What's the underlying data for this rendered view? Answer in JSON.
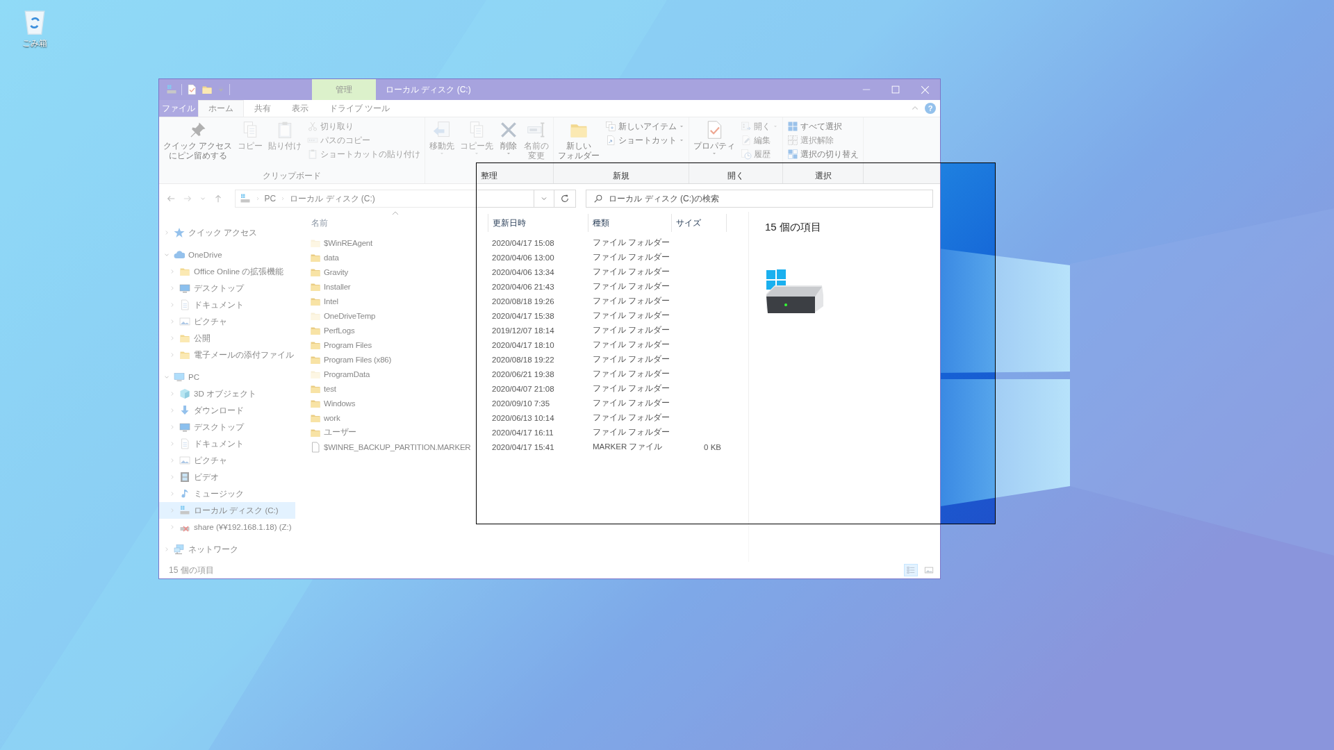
{
  "desktop_icons": [
    {
      "label": "ごみ箱"
    }
  ],
  "window": {
    "title": "ローカル ディスク (C:)",
    "context_tab": "管理"
  },
  "ribbon": {
    "tabs": [
      {
        "label": "ファイル",
        "kind": "file",
        "selected": false
      },
      {
        "label": "ホーム",
        "kind": "tab",
        "selected": true
      },
      {
        "label": "共有",
        "kind": "tab",
        "selected": false
      },
      {
        "label": "表示",
        "kind": "tab",
        "selected": false
      },
      {
        "label": "ドライブ ツール",
        "kind": "tab",
        "selected": false
      }
    ],
    "help": "?",
    "groups": [
      {
        "label": "クリップボード",
        "items": [
          {
            "kind": "large",
            "label": [
              "クイック アクセス",
              "にピン留めする"
            ],
            "disabled": false,
            "dropdown": false
          },
          {
            "kind": "large",
            "label": [
              "コピー"
            ],
            "disabled": true,
            "dropdown": false
          },
          {
            "kind": "large",
            "label": [
              "貼り付け"
            ],
            "disabled": true,
            "dropdown": false
          },
          {
            "kind": "small",
            "label": "切り取り",
            "disabled": true,
            "dropdown": false
          },
          {
            "kind": "small",
            "label": "パスのコピー",
            "disabled": true,
            "dropdown": false
          },
          {
            "kind": "small",
            "label": "ショートカットの貼り付け",
            "disabled": true,
            "dropdown": false
          }
        ]
      },
      {
        "label": "整理",
        "items": [
          {
            "kind": "large",
            "label": [
              "移動先"
            ],
            "disabled": true,
            "dropdown": true
          },
          {
            "kind": "large",
            "label": [
              "コピー先"
            ],
            "disabled": true,
            "dropdown": true
          },
          {
            "kind": "large",
            "label": [
              "削除"
            ],
            "disabled": false,
            "dropdown": true
          },
          {
            "kind": "large",
            "label": [
              "名前の",
              "変更"
            ],
            "disabled": true,
            "dropdown": false
          }
        ]
      },
      {
        "label": "新規",
        "items": [
          {
            "kind": "large",
            "label": [
              "新しい",
              "フォルダー"
            ],
            "disabled": false,
            "dropdown": false
          },
          {
            "kind": "small",
            "label": "新しいアイテム",
            "disabled": false,
            "dropdown": true
          },
          {
            "kind": "small",
            "label": "ショートカット",
            "disabled": false,
            "dropdown": true
          }
        ]
      },
      {
        "label": "開く",
        "items": [
          {
            "kind": "large",
            "label": [
              "プロパティ"
            ],
            "disabled": false,
            "dropdown": true
          },
          {
            "kind": "small",
            "label": "開く",
            "disabled": true,
            "dropdown": true
          },
          {
            "kind": "small",
            "label": "編集",
            "disabled": true,
            "dropdown": false
          },
          {
            "kind": "small",
            "label": "履歴",
            "disabled": true,
            "dropdown": false
          }
        ]
      },
      {
        "label": "選択",
        "items": [
          {
            "kind": "small",
            "label": "すべて選択",
            "disabled": false,
            "dropdown": false
          },
          {
            "kind": "small",
            "label": "選択解除",
            "disabled": true,
            "dropdown": false
          },
          {
            "kind": "small",
            "label": "選択の切り替え",
            "disabled": false,
            "dropdown": false
          }
        ]
      }
    ]
  },
  "address": {
    "crumbs": [
      "PC",
      "ローカル ディスク (C:)"
    ]
  },
  "search": {
    "placeholder": "ローカル ディスク (C:)の検索"
  },
  "nav": {
    "items": [
      {
        "label": "クイック アクセス",
        "kind": "star",
        "expanded": false,
        "selected": false
      },
      {
        "label": "OneDrive",
        "kind": "cloud",
        "expanded": true,
        "selected": false,
        "children": [
          {
            "label": "Office Online の拡張機能",
            "kind": "folder",
            "expanded": false,
            "selected": false
          },
          {
            "label": "デスクトップ",
            "kind": "desktop",
            "expanded": false,
            "selected": false
          },
          {
            "label": "ドキュメント",
            "kind": "document",
            "expanded": false,
            "selected": false
          },
          {
            "label": "ピクチャ",
            "kind": "picture",
            "expanded": false,
            "selected": false
          },
          {
            "label": "公開",
            "kind": "folder",
            "expanded": false,
            "selected": false
          },
          {
            "label": "電子メールの添付ファイル",
            "kind": "folder",
            "expanded": false,
            "selected": false
          }
        ]
      },
      {
        "label": "PC",
        "kind": "pc",
        "expanded": true,
        "selected": false,
        "children": [
          {
            "label": "3D オブジェクト",
            "kind": "cube",
            "expanded": false,
            "selected": false
          },
          {
            "label": "ダウンロード",
            "kind": "download",
            "expanded": false,
            "selected": false
          },
          {
            "label": "デスクトップ",
            "kind": "desktop",
            "expanded": false,
            "selected": false
          },
          {
            "label": "ドキュメント",
            "kind": "document",
            "expanded": false,
            "selected": false
          },
          {
            "label": "ピクチャ",
            "kind": "picture",
            "expanded": false,
            "selected": false
          },
          {
            "label": "ビデオ",
            "kind": "video",
            "expanded": false,
            "selected": false
          },
          {
            "label": "ミュージック",
            "kind": "music",
            "expanded": false,
            "selected": false
          },
          {
            "label": "ローカル ディスク (C:)",
            "kind": "drive",
            "expanded": false,
            "selected": true
          },
          {
            "label": "share (¥¥192.168.1.18) (Z:)",
            "kind": "netdrive",
            "expanded": false,
            "selected": false
          }
        ]
      },
      {
        "label": "ネットワーク",
        "kind": "network",
        "expanded": false,
        "selected": false
      }
    ]
  },
  "table": {
    "columns": [
      {
        "label": "名前",
        "sorted": true
      },
      {
        "label": "更新日時",
        "sorted": false
      },
      {
        "label": "種類",
        "sorted": false
      },
      {
        "label": "サイズ",
        "sorted": false
      }
    ],
    "rows": [
      {
        "name": "$WinREAgent",
        "modified": "2020/04/17 15:08",
        "type": "ファイル フォルダー",
        "kind": "folder",
        "hidden": true
      },
      {
        "name": "data",
        "modified": "2020/04/06 13:00",
        "type": "ファイル フォルダー",
        "kind": "folder",
        "hidden": false
      },
      {
        "name": "Gravity",
        "modified": "2020/04/06 13:34",
        "type": "ファイル フォルダー",
        "kind": "folder",
        "hidden": false
      },
      {
        "name": "Installer",
        "modified": "2020/04/06 21:43",
        "type": "ファイル フォルダー",
        "kind": "folder",
        "hidden": false
      },
      {
        "name": "Intel",
        "modified": "2020/08/18 19:26",
        "type": "ファイル フォルダー",
        "kind": "folder",
        "hidden": false
      },
      {
        "name": "OneDriveTemp",
        "modified": "2020/04/17 15:38",
        "type": "ファイル フォルダー",
        "kind": "folder",
        "hidden": true
      },
      {
        "name": "PerfLogs",
        "modified": "2019/12/07 18:14",
        "type": "ファイル フォルダー",
        "kind": "folder",
        "hidden": false
      },
      {
        "name": "Program Files",
        "modified": "2020/04/17 18:10",
        "type": "ファイル フォルダー",
        "kind": "folder",
        "hidden": false
      },
      {
        "name": "Program Files (x86)",
        "modified": "2020/08/18 19:22",
        "type": "ファイル フォルダー",
        "kind": "folder",
        "hidden": false
      },
      {
        "name": "ProgramData",
        "modified": "2020/06/21 19:38",
        "type": "ファイル フォルダー",
        "kind": "folder",
        "hidden": true
      },
      {
        "name": "test",
        "modified": "2020/04/07 21:08",
        "type": "ファイル フォルダー",
        "kind": "folder",
        "hidden": false
      },
      {
        "name": "Windows",
        "modified": "2020/09/10 7:35",
        "type": "ファイル フォルダー",
        "kind": "folder",
        "hidden": false
      },
      {
        "name": "work",
        "modified": "2020/06/13 10:14",
        "type": "ファイル フォルダー",
        "kind": "folder",
        "hidden": false
      },
      {
        "name": "ユーザー",
        "modified": "2020/04/17 16:11",
        "type": "ファイル フォルダー",
        "kind": "folder",
        "hidden": false
      },
      {
        "name": "$WINRE_BACKUP_PARTITION.MARKER",
        "modified": "2020/04/17 15:41",
        "type": "MARKER ファイル",
        "size": "0 KB",
        "kind": "file",
        "hidden": false
      }
    ]
  },
  "details": {
    "summary": "15 個の項目"
  },
  "status_bar": {
    "text": "15 個の項目",
    "views": [
      {
        "kind": "details",
        "selected": true
      },
      {
        "kind": "large_icons",
        "selected": false
      }
    ]
  }
}
